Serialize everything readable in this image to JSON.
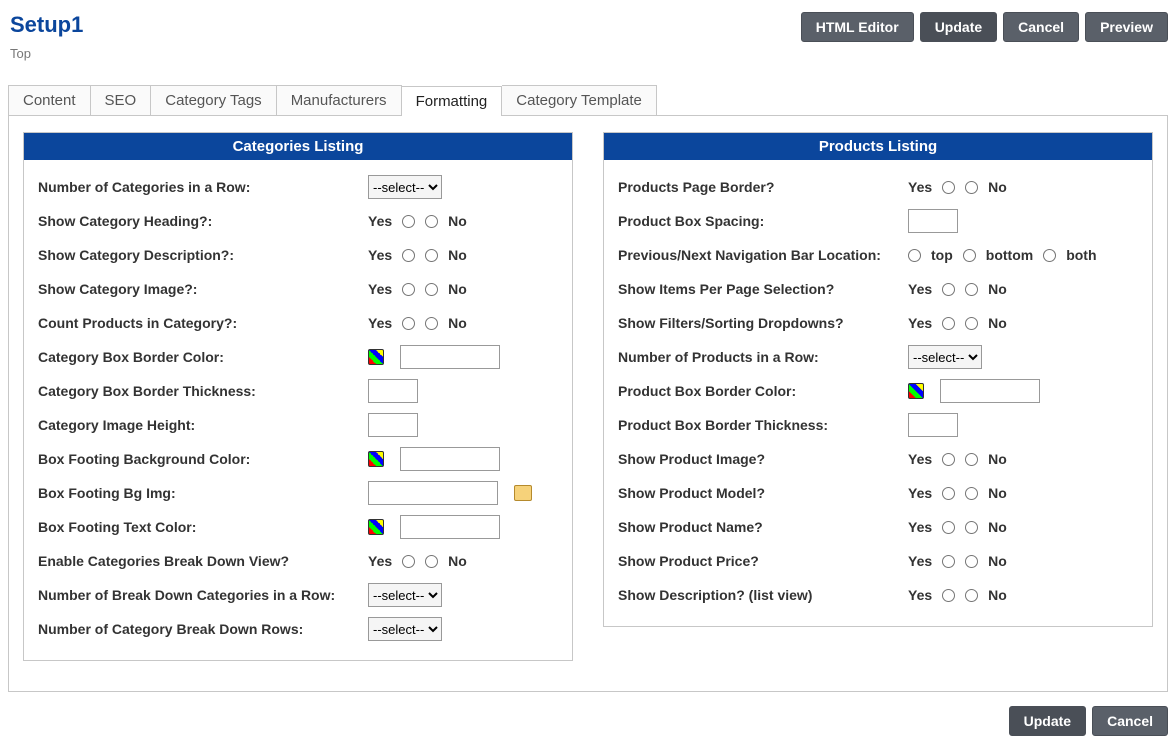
{
  "header": {
    "title": "Setup1",
    "breadcrumb": "Top",
    "buttons": {
      "html_editor": "HTML Editor",
      "update": "Update",
      "cancel": "Cancel",
      "preview": "Preview"
    }
  },
  "tabs": [
    "Content",
    "SEO",
    "Category Tags",
    "Manufacturers",
    "Formatting",
    "Category Template"
  ],
  "activeTab": "Formatting",
  "categories_panel": {
    "title": "Categories Listing",
    "num_in_row": {
      "label": "Number of Categories in a Row:",
      "value": "--select--"
    },
    "show_heading": {
      "label": "Show Category Heading?:",
      "yes": "Yes",
      "no": "No"
    },
    "show_desc": {
      "label": "Show Category Description?:",
      "yes": "Yes",
      "no": "No"
    },
    "show_image": {
      "label": "Show Category Image?:",
      "yes": "Yes",
      "no": "No"
    },
    "count_prod": {
      "label": "Count Products in Category?:",
      "yes": "Yes",
      "no": "No"
    },
    "border_color": {
      "label": "Category Box Border Color:"
    },
    "border_thick": {
      "label": "Category Box Border Thickness:"
    },
    "img_height": {
      "label": "Category Image Height:"
    },
    "foot_bg_color": {
      "label": "Box Footing Background Color:"
    },
    "foot_bg_img": {
      "label": "Box Footing Bg Img:"
    },
    "foot_text_clr": {
      "label": "Box Footing Text Color:"
    },
    "enable_break": {
      "label": "Enable Categories Break Down View?",
      "yes": "Yes",
      "no": "No"
    },
    "break_cats": {
      "label": "Number of Break Down Categories in a Row:",
      "value": "--select--"
    },
    "break_rows": {
      "label": "Number of Category Break Down Rows:",
      "value": "--select--"
    }
  },
  "products_panel": {
    "title": "Products Listing",
    "page_border": {
      "label": "Products Page Border?",
      "yes": "Yes",
      "no": "No"
    },
    "box_spacing": {
      "label": "Product Box Spacing:"
    },
    "nav_loc": {
      "label": "Previous/Next Navigation Bar Location:",
      "top": "top",
      "bottom": "bottom",
      "both": "both"
    },
    "items_pp": {
      "label": "Show Items Per Page Selection?",
      "yes": "Yes",
      "no": "No"
    },
    "filters": {
      "label": "Show Filters/Sorting Dropdowns?",
      "yes": "Yes",
      "no": "No"
    },
    "num_in_row": {
      "label": "Number of Products in a Row:",
      "value": "--select--"
    },
    "border_color": {
      "label": "Product Box Border Color:"
    },
    "border_thick": {
      "label": "Product Box Border Thickness:"
    },
    "show_image": {
      "label": "Show Product Image?",
      "yes": "Yes",
      "no": "No"
    },
    "show_model": {
      "label": "Show Product Model?",
      "yes": "Yes",
      "no": "No"
    },
    "show_name": {
      "label": "Show Product Name?",
      "yes": "Yes",
      "no": "No"
    },
    "show_price": {
      "label": "Show Product Price?",
      "yes": "Yes",
      "no": "No"
    },
    "show_desc": {
      "label": "Show Description? (list view)",
      "yes": "Yes",
      "no": "No"
    }
  },
  "footer_buttons": {
    "update": "Update",
    "cancel": "Cancel"
  }
}
